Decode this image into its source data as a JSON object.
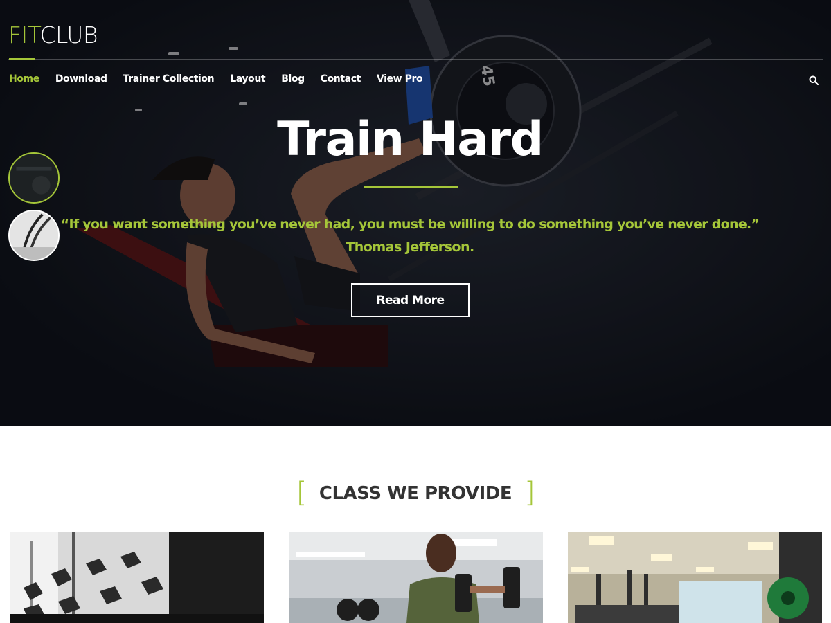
{
  "brand": {
    "fit": "FIT",
    "club": "CLUB"
  },
  "nav": {
    "items": [
      {
        "label": "Home",
        "active": true
      },
      {
        "label": "Download"
      },
      {
        "label": "Trainer Collection"
      },
      {
        "label": "Layout"
      },
      {
        "label": "Blog"
      },
      {
        "label": "Contact"
      },
      {
        "label": "View Pro"
      }
    ],
    "search_icon": "search-icon"
  },
  "hero": {
    "title": "Train Hard",
    "quote": "“If you want something you’ve never had, you must be willing to do something you’ve never done.”",
    "author": "Thomas Jefferson.",
    "cta_label": "Read More",
    "plate_label": "45"
  },
  "section": {
    "open_bracket": "[",
    "heading": "CLASS WE PROVIDE",
    "close_bracket": "]"
  },
  "colors": {
    "accent": "#a5c639",
    "hero_bg": "#0f1219",
    "text_dark": "#333333"
  }
}
